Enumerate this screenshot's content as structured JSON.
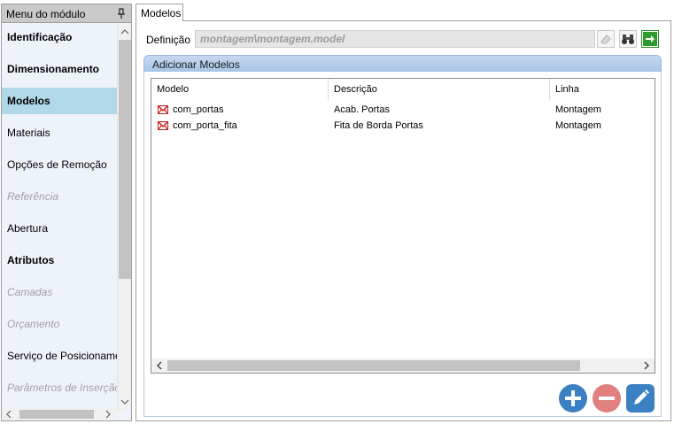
{
  "sidebar": {
    "title": "Menu do módulo",
    "items": [
      {
        "label": "Identificação",
        "style": "bold"
      },
      {
        "label": "Dimensionamento",
        "style": "bold"
      },
      {
        "label": "Modelos",
        "style": "bold selected"
      },
      {
        "label": "Materiais",
        "style": ""
      },
      {
        "label": "Opções de Remoção",
        "style": ""
      },
      {
        "label": "Referência",
        "style": "disabled"
      },
      {
        "label": "Abertura",
        "style": ""
      },
      {
        "label": "Atributos",
        "style": "bold"
      },
      {
        "label": "Camadas",
        "style": "disabled"
      },
      {
        "label": "Orçamento",
        "style": "disabled"
      },
      {
        "label": "Serviço de Posicionamento",
        "style": ""
      },
      {
        "label": "Parâmetros de Inserção",
        "style": "disabled"
      }
    ]
  },
  "tab": {
    "label": "Modelos"
  },
  "definition": {
    "label": "Definição",
    "value": "montagem\\montagem.model"
  },
  "group": {
    "title": "Adicionar Modelos"
  },
  "grid": {
    "columns": [
      "Modelo",
      "Descrição",
      "Linha"
    ],
    "rows": [
      {
        "modelo": "com_portas",
        "descricao": "Acab. Portas",
        "linha": "Montagem"
      },
      {
        "modelo": "com_porta_fita",
        "descricao": "Fita de Borda Portas",
        "linha": "Montagem"
      }
    ]
  },
  "colors": {
    "selected": "#b0d8e8",
    "accent_blue": "#3a80c2",
    "remove_red": "#e0807f",
    "go_green": "#2e8b2e"
  }
}
